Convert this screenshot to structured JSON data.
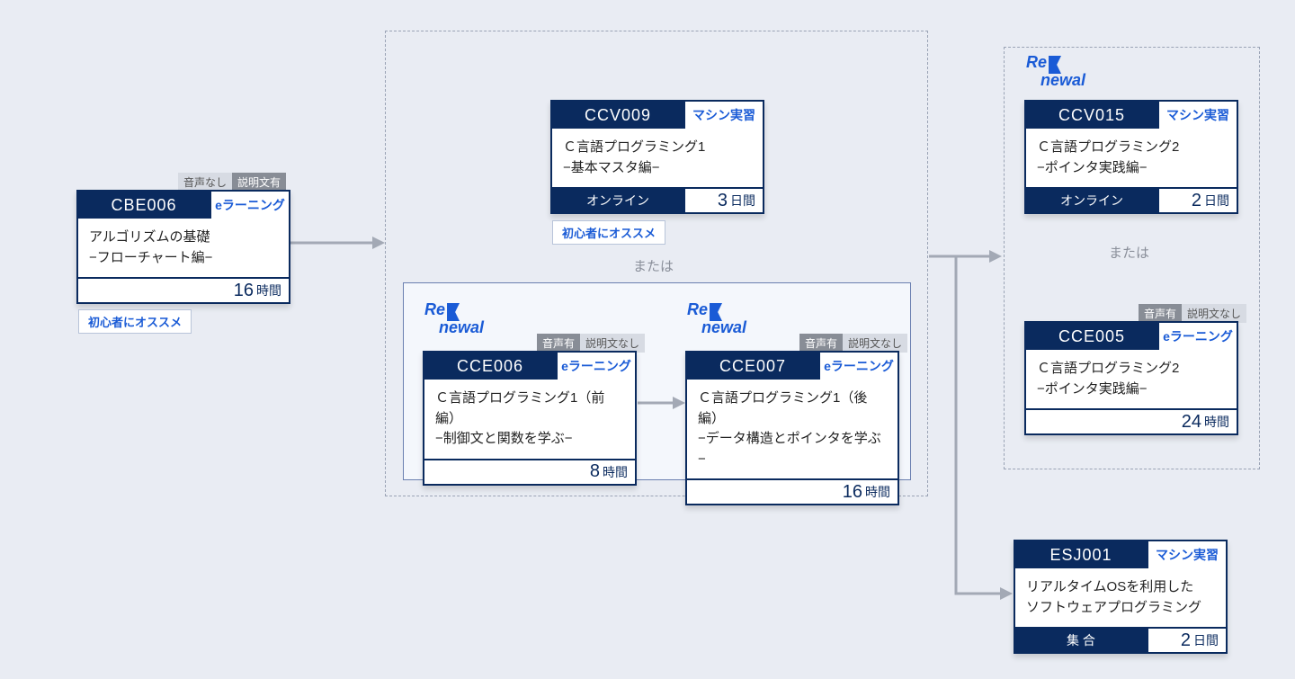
{
  "or_label": "または",
  "recommend_label": "初心者にオススメ",
  "renewal": {
    "line1": "Re",
    "line2": "newal"
  },
  "cards": {
    "cbe006": {
      "code": "CBE006",
      "type": "eラーニング",
      "title": "アルゴリズムの基礎\n−フローチャート編−",
      "dur_num": "16",
      "dur_unit": "時間",
      "tag1": "音声なし",
      "tag2": "説明文有"
    },
    "ccv009": {
      "code": "CCV009",
      "type": "マシン実習",
      "title": "Ｃ言語プログラミング1\n−基本マスタ編−",
      "mode": "オンライン",
      "dur_num": "3",
      "dur_unit": "日間"
    },
    "cce006": {
      "code": "CCE006",
      "type": "eラーニング",
      "title": "Ｃ言語プログラミング1（前編）\n−制御文と関数を学ぶ−",
      "dur_num": "8",
      "dur_unit": "時間",
      "tag1": "音声有",
      "tag2": "説明文なし"
    },
    "cce007": {
      "code": "CCE007",
      "type": "eラーニング",
      "title": "Ｃ言語プログラミング1（後編）\n−データ構造とポインタを学ぶ−",
      "dur_num": "16",
      "dur_unit": "時間",
      "tag1": "音声有",
      "tag2": "説明文なし"
    },
    "ccv015": {
      "code": "CCV015",
      "type": "マシン実習",
      "title": "Ｃ言語プログラミング2\n−ポインタ実践編−",
      "mode": "オンライン",
      "dur_num": "2",
      "dur_unit": "日間"
    },
    "cce005": {
      "code": "CCE005",
      "type": "eラーニング",
      "title": "Ｃ言語プログラミング2\n−ポインタ実践編−",
      "dur_num": "24",
      "dur_unit": "時間",
      "tag1": "音声有",
      "tag2": "説明文なし"
    },
    "esj001": {
      "code": "ESJ001",
      "type": "マシン実習",
      "title": "リアルタイムOSを利用した\nソフトウェアプログラミング",
      "mode": "集 合",
      "dur_num": "2",
      "dur_unit": "日間"
    }
  }
}
